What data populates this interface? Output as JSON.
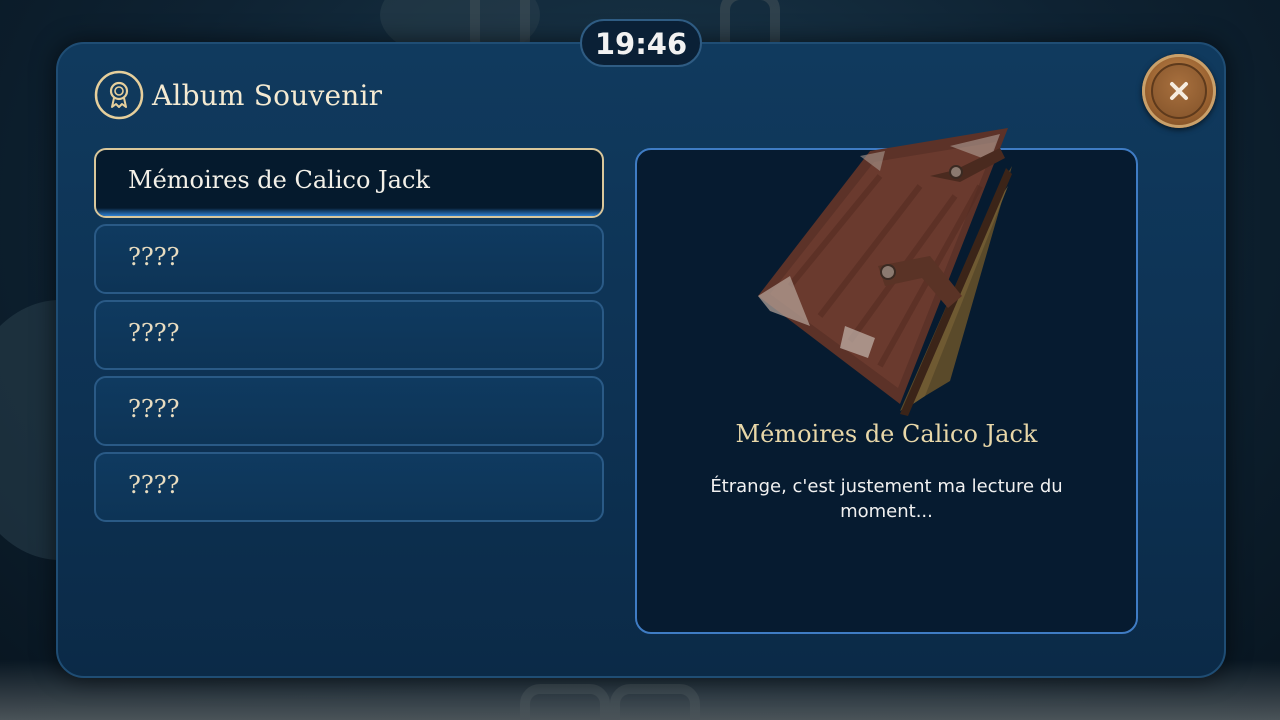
{
  "timer": "19:46",
  "album": {
    "title": "Album Souvenir",
    "icon": "medal-icon"
  },
  "close": {
    "icon": "close-icon"
  },
  "list": {
    "items": [
      {
        "label": "Mémoires de Calico Jack",
        "selected": true
      },
      {
        "label": "????",
        "selected": false
      },
      {
        "label": "????",
        "selected": false
      },
      {
        "label": "????",
        "selected": false
      },
      {
        "label": "????",
        "selected": false
      }
    ]
  },
  "detail": {
    "title": "Mémoires de Calico Jack",
    "description": "Étrange, c'est justement ma lecture du moment...",
    "image": "leather-book-image"
  },
  "colors": {
    "panel": "#0d3152",
    "selected_border": "#d9c79b",
    "card_border": "#3f7cc4",
    "accent_gold": "#e8d7a8"
  }
}
